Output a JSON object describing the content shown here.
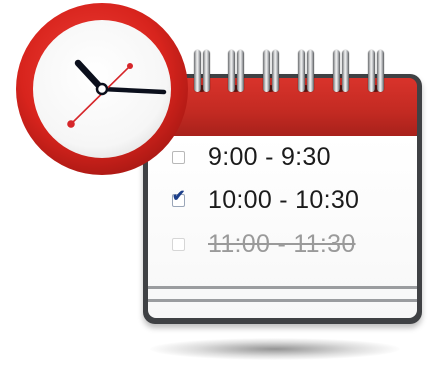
{
  "icons": {
    "clock": "clock-icon",
    "calendar": "calendar-icon",
    "checkbox": "checkbox-icon"
  },
  "colors": {
    "clock_rim": "#e0261f",
    "calendar_header": "#c8261f",
    "checkmark": "#1d3f8a",
    "second_hand": "#d6262a"
  },
  "schedule": {
    "slots": [
      {
        "label": "9:00 - 9:30",
        "checked": false,
        "struck": false
      },
      {
        "label": "10:00 - 10:30",
        "checked": true,
        "struck": false
      },
      {
        "label": "11:00 - 11:30",
        "checked": false,
        "struck": true
      }
    ]
  }
}
